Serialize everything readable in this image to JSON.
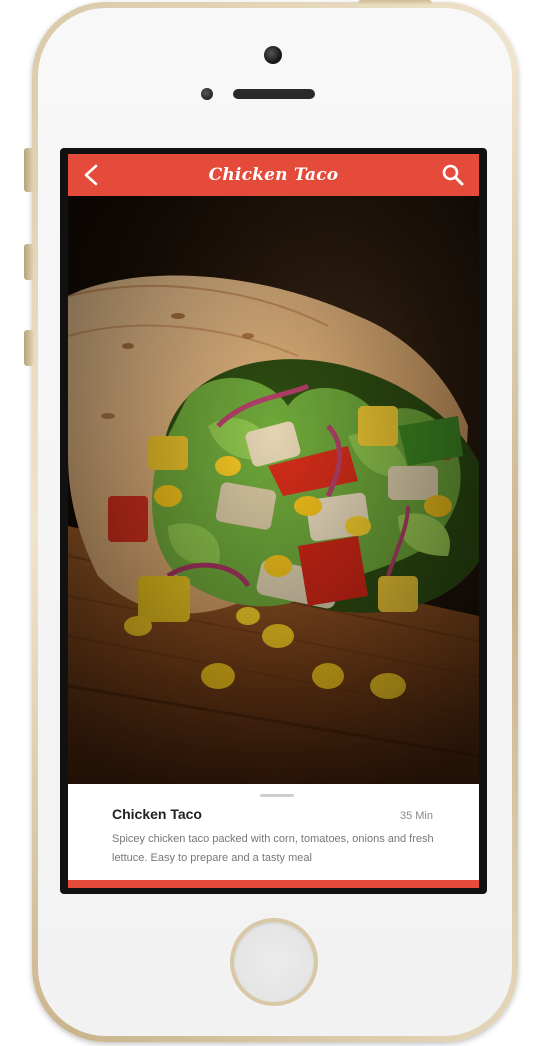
{
  "header": {
    "title": "Chicken Taco",
    "back_icon": "back-chevron-icon",
    "search_icon": "search-icon"
  },
  "hero": {
    "image_subject": "chicken taco wrap"
  },
  "recipe": {
    "name": "Chicken Taco",
    "time": "35 Min",
    "description": "Spicey chicken taco packed with corn, tomatoes, onions and fresh lettuce. Easy to prepare and a tasty meal"
  },
  "colors": {
    "accent": "#e44b3a",
    "background": "#ffffff",
    "text_primary": "#222222",
    "text_secondary": "#777777"
  }
}
